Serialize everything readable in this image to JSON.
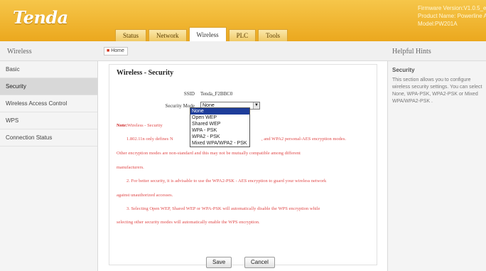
{
  "header": {
    "logo": "Tenda",
    "firmware": "Firmware Version:V1.0.5_en",
    "product": "Product Name: Powerline AP",
    "model": "Model:PW201A",
    "tabs": [
      {
        "label": "Status"
      },
      {
        "label": "Network"
      },
      {
        "label": "Wireless"
      },
      {
        "label": "PLC"
      },
      {
        "label": "Tools"
      }
    ]
  },
  "left_title": "Wireless",
  "home_button": "Home",
  "right_title": "Helpful Hints",
  "sidebar": {
    "items": [
      {
        "label": "Basic"
      },
      {
        "label": "Security"
      },
      {
        "label": "Wireless Access Control"
      },
      {
        "label": "WPS"
      },
      {
        "label": "Connection Status"
      }
    ]
  },
  "main": {
    "title": "Wireless - Security",
    "ssid_label": "SSID",
    "ssid_value": "Tenda_F2BBC0",
    "mode_label": "Security Mode",
    "mode_value": "None",
    "mode_options": [
      "None",
      "Open WEP",
      "Shared WEP",
      "WPA - PSK",
      "WPA2 - PSK",
      "Mixed WPA/WPA2 - PSK"
    ],
    "note_prefix": "Note:",
    "note_heading": "Wireless - Security",
    "note_line1a": "1.802.11n only defines N",
    "note_line1b": ", and WPA2 personal-AES encryption modes.",
    "note_line2": "Other encryption modes are non-standard and this may not be mutually compatible among different",
    "note_line3": "manufacturers.",
    "note_line4": "2. For better security, it is advisable to use the WPA2-PSK - AES encryption to guard your wireless network",
    "note_line5": "against unauthorized accesses.",
    "note_line6": "3. Selecting Open WEP, Shared WEP or WPA-PSK will automatically disable the WPS encryption while",
    "note_line7": "selecting other security modes will automatically enable the WPS encryption.",
    "save_label": "Save",
    "cancel_label": "Cancel"
  },
  "help": {
    "title": "Security",
    "body": "This section allows you to configure wireless security settings. You can select None, WPA-PSK, WPA2-PSK or Mixed WPA/WPA2-PSK ."
  },
  "colors": {
    "header": "#eba81e",
    "note_text": "#e04a4a",
    "selected_option": "#1e3d9a"
  }
}
